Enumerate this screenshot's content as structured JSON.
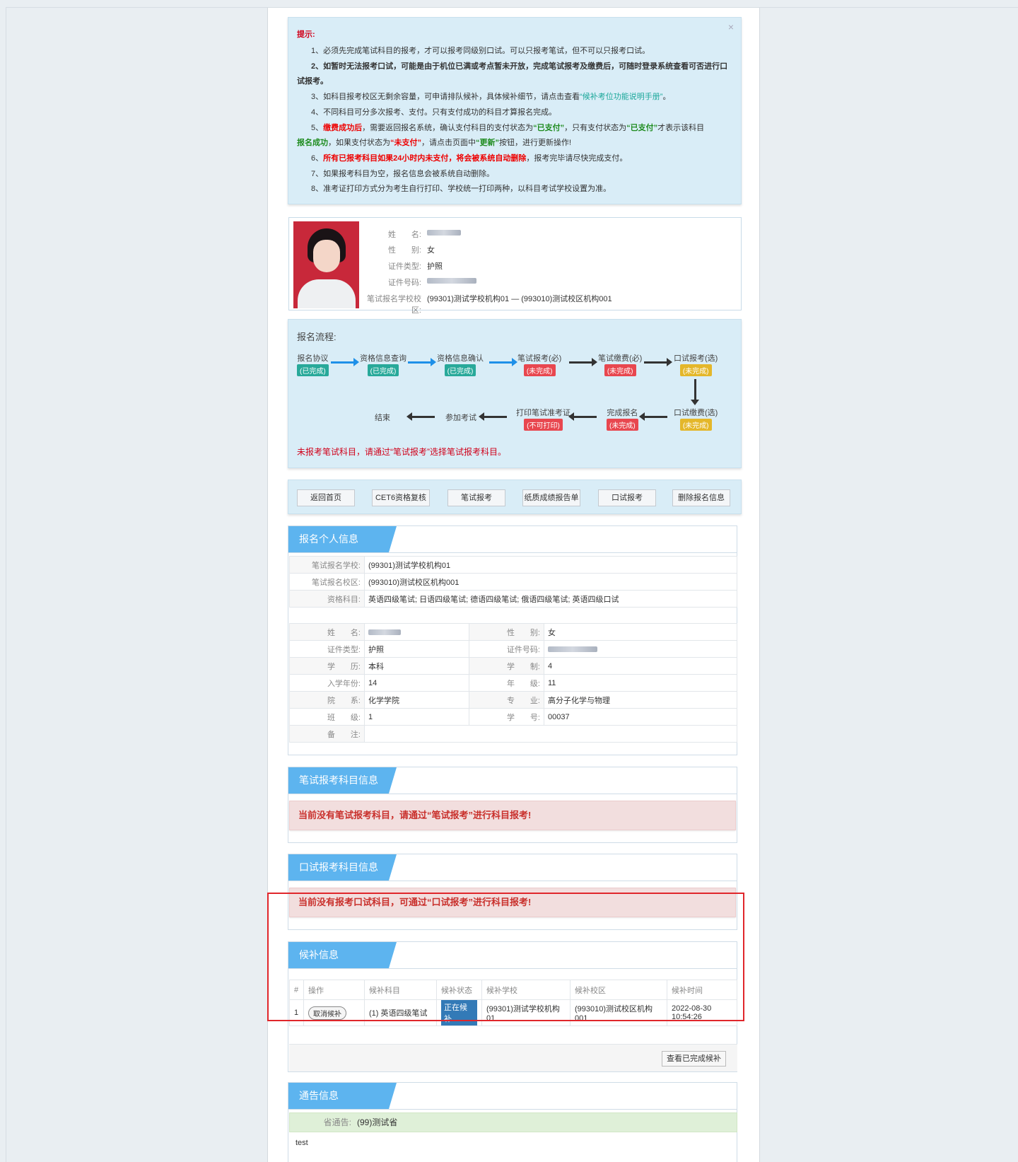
{
  "tips": {
    "title": "提示:",
    "l1": "1、必须先完成笔试科目的报考，才可以报考同级别口试。可以只报考笔试，但不可以只报考口试。",
    "l2": "2、如暂时无法报考口试，可能是由于机位已满或考点暂未开放，完成笔试报考及缴费后，可随时登录系统查看可否进行口",
    "l2b": "试报考。",
    "l3a": "3、如科目报考校区无剩余容量，可申请排队候补，具体候补细节，请点击查看",
    "l3link": "“候补考位功能说明手册”",
    "l3b": "。",
    "l4": "4、不同科目可分多次报考、支付。只有支付成功的科目才算报名完成。",
    "l5a": "5、",
    "l5b": "缴费成功后",
    "l5c": "，需要返回报名系统，确认支付科目的支付状态为",
    "l5d": "“已支付”",
    "l5e": "，只有支付状态为",
    "l5f": "“已支付”",
    "l5g": "才表示该科目",
    "l5h": "报名成功",
    "l5i": "，如果支付状态为",
    "l5j": "“未支付”",
    "l5k": "，请点击页面中",
    "l5l": "“更新”",
    "l5m": "按钮，进行更新操作!",
    "l6a": "6、",
    "l6b": "所有已报考科目如果24小时内未支付，将会被系统自动删除",
    "l6c": "，报考完毕请尽快完成支付。",
    "l7": "7、如果报考科目为空，报名信息会被系统自动删除。",
    "l8": "8、准考证打印方式分为考生自行打印、学校统一打印两种，以科目考试学校设置为准。"
  },
  "profile": {
    "name_label": "姓　　名:",
    "gender_label": "性　　别:",
    "gender": "女",
    "idtype_label": "证件类型:",
    "idtype": "护照",
    "idno_label": "证件号码:",
    "school_label": "笔试报名学校校区:",
    "school": "(99301)测试学校机构01 — (993010)测试校区机构001"
  },
  "flow": {
    "title": "报名流程:",
    "n1": "报名协议",
    "s1": "(已完成)",
    "n2": "资格信息查询",
    "s2": "(已完成)",
    "n3": "资格信息确认",
    "s3": "(已完成)",
    "n4": "笔试报考(必)",
    "s4": "(未完成)",
    "n5": "笔试缴费(必)",
    "s5": "(未完成)",
    "n6": "口试报考(选)",
    "s6": "(未完成)",
    "n7": "口试缴费(选)",
    "s7": "(未完成)",
    "n8": "完成报名",
    "s8": "(未完成)",
    "n9": "打印笔试准考证",
    "s9": "(不可打印)",
    "n10": "参加考试",
    "n11": "结束",
    "warning": "未报考笔试科目，请通过“笔试报考”选择笔试报考科目。"
  },
  "buttons": [
    "返回首页",
    "CET6资格复核",
    "笔试报考",
    "纸质成绩报告单",
    "口试报考",
    "删除报名信息"
  ],
  "personal": {
    "title": "报名个人信息",
    "school_k": "笔试报名学校:",
    "school_v": "(99301)测试学校机构01",
    "campus_k": "笔试报名校区:",
    "campus_v": "(993010)测试校区机构001",
    "subj_k": "资格科目:",
    "subj_v": "英语四级笔试; 日语四级笔试; 德语四级笔试; 俄语四级笔试; 英语四级口试",
    "name_k": "姓　　名:",
    "gender_k": "性　　别:",
    "gender_v": "女",
    "idtype_k": "证件类型:",
    "idtype_v": "护照",
    "idno_k": "证件号码:",
    "edu_k": "学　　历:",
    "edu_v": "本科",
    "len_k": "学　　制:",
    "len_v": "4",
    "year_k": "入学年份:",
    "year_v": "14",
    "grade_k": "年　　级:",
    "grade_v": "11",
    "dept_k": "院　　系:",
    "dept_v": "化学学院",
    "major_k": "专　　业:",
    "major_v": "高分子化学与物理",
    "class_k": "班　　级:",
    "class_v": "1",
    "sno_k": "学　　号:",
    "sno_v": "00037",
    "note_k": "备　　注:",
    "note_v": ""
  },
  "written": {
    "title": "笔试报考科目信息",
    "alert": "当前没有笔试报考科目，请通过“笔试报考”进行科目报考!"
  },
  "oral": {
    "title": "口试报考科目信息",
    "alert": "当前没有报考口试科目，可通过“口试报考”进行科目报考!"
  },
  "waitlist": {
    "title": "候补信息",
    "headers": [
      "#",
      "操作",
      "候补科目",
      "候补状态",
      "候补学校",
      "候补校区",
      "候补时间"
    ],
    "row": {
      "no": "1",
      "action": "取消候补",
      "subject": "(1) 英语四级笔试",
      "status": "正在候补",
      "school": "(99301)测试学校机构01",
      "campus": "(993010)测试校区机构001",
      "time": "2022-08-30 10:54:26"
    },
    "done_button": "查看已完成候补"
  },
  "notice": {
    "title": "通告信息",
    "prov_k": "省通告:",
    "prov_v": "(99)测试省",
    "content": "test"
  }
}
